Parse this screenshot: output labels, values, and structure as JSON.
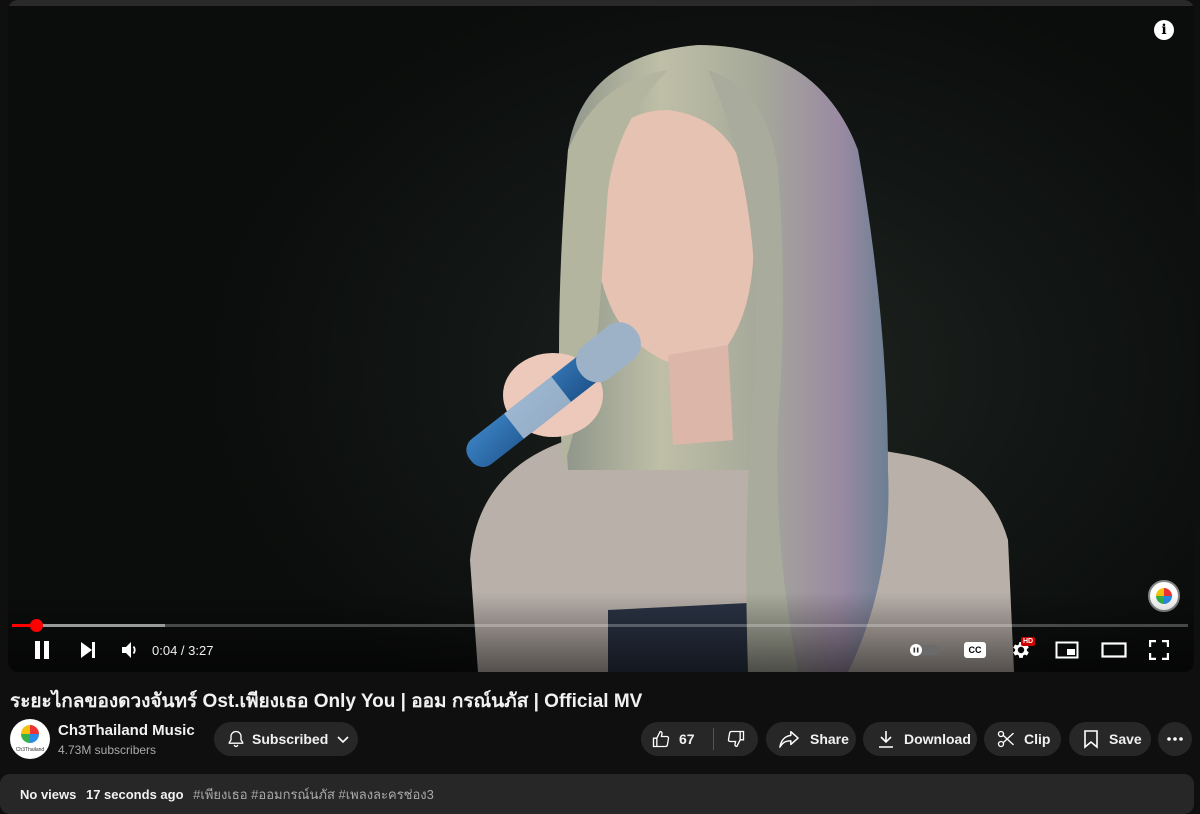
{
  "video": {
    "title": "ระยะไกลของดวงจันทร์ Ost.เพียงเธอ Only You | ออม กรณ์นภัส | Official MV",
    "current_time": "0:04",
    "duration": "3:27",
    "time_display": "0:04 / 3:27",
    "progress_fraction": 0.02,
    "buffered_fraction": 0.13
  },
  "player_icons": [
    "pause-icon",
    "next-icon",
    "volume-icon",
    "autoplay-toggle-icon",
    "captions-icon",
    "settings-icon",
    "miniplayer-icon",
    "theater-icon",
    "fullscreen-icon",
    "info-icon"
  ],
  "settings_badge": "HD",
  "captions_label": "CC",
  "channel": {
    "name": "Ch3Thailand Music",
    "subscribers": "4.73M subscribers",
    "subscribe_label": "Subscribed"
  },
  "actions": {
    "like_count": "67",
    "share": "Share",
    "download": "Download",
    "clip": "Clip",
    "save": "Save"
  },
  "description": {
    "views": "No views",
    "age": "17 seconds ago",
    "hashtags": "#เพียงเธอ #ออมกรณ์นภัส #เพลงละครช่อง3"
  },
  "colors": {
    "background": "#0f0f0f",
    "button_bg": "#272727",
    "progress_red": "#ff0000",
    "hd_badge": "#cc0000"
  }
}
